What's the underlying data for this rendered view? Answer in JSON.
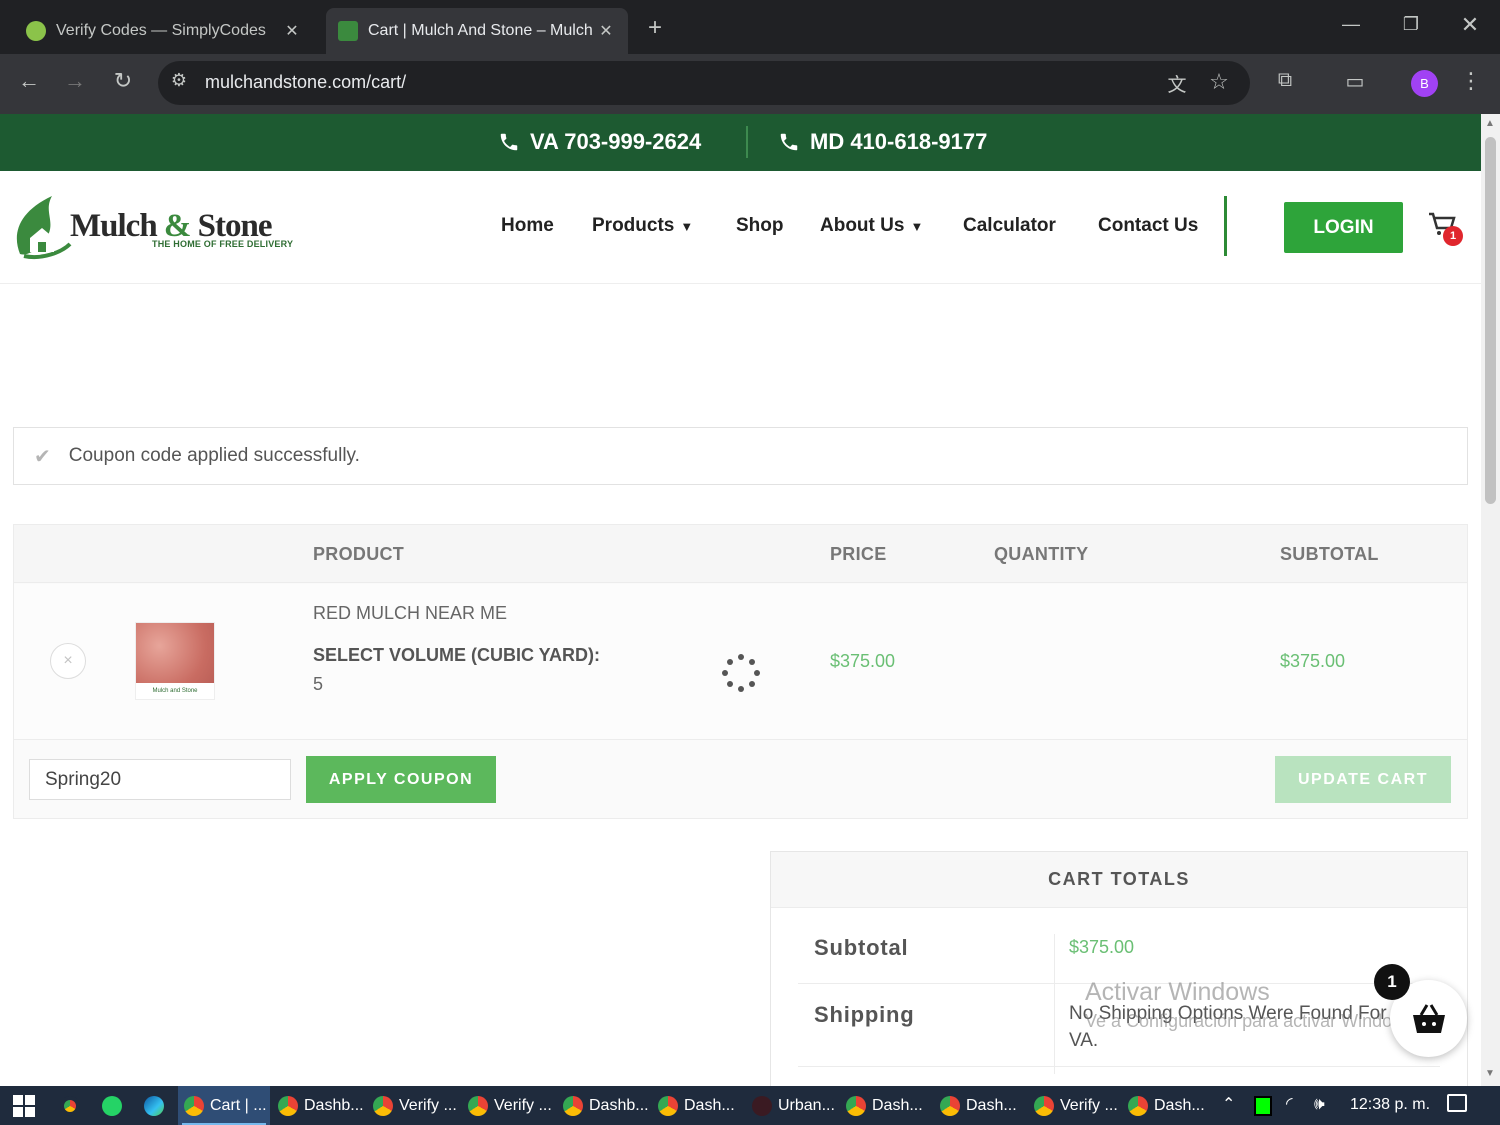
{
  "browser": {
    "tabs": [
      {
        "title": "Verify Codes — SimplyCodes",
        "active": false
      },
      {
        "title": "Cart | Mulch And Stone – Mulch",
        "active": true
      }
    ],
    "new_tab": "+",
    "url": "mulchandstone.com/cart/",
    "profile_initial": "B"
  },
  "site": {
    "phones": [
      {
        "label": "VA 703-999-2624"
      },
      {
        "label": "MD 410-618-9177"
      }
    ],
    "logo": {
      "name_part1": "Mulch ",
      "amp": "&",
      "name_part2": " Stone",
      "tagline": "THE HOME OF FREE DELIVERY"
    },
    "nav": [
      "Home",
      "Products",
      "Shop",
      "About Us",
      "Calculator",
      "Contact Us"
    ],
    "login": "LOGIN",
    "cart_count": "1"
  },
  "notice": "Coupon code applied successfully.",
  "cart": {
    "headers": {
      "product": "PRODUCT",
      "price": "PRICE",
      "quantity": "QUANTITY",
      "subtotal": "SUBTOTAL"
    },
    "item": {
      "remove": "×",
      "thumb_label": "Mulch and Stone",
      "name": "RED MULCH NEAR ME",
      "meta_key": "SELECT VOLUME (CUBIC YARD):",
      "meta_value": "5",
      "price": "$375.00",
      "subtotal": "$375.00"
    },
    "coupon_value": "Spring20",
    "apply_label": "APPLY COUPON",
    "update_label": "UPDATE CART"
  },
  "totals": {
    "heading": "CART TOTALS",
    "subtotal_label": "Subtotal",
    "subtotal_value": "$375.00",
    "shipping_label": "Shipping",
    "shipping_value": "No Shipping Options Were Found For VA."
  },
  "watermark": {
    "line1": "Activar Windows",
    "line2": "Ve a Configuración para activar Windows."
  },
  "basket_count": "1",
  "taskbar": {
    "items": [
      "Cart | ...",
      "Dashb...",
      "Verify ...",
      "Verify ...",
      "Dashb...",
      "Dash...",
      "Urban...",
      "Dash...",
      "Dash...",
      "Verify ...",
      "Dash..."
    ],
    "clock": "12:38 p. m."
  },
  "colors": {
    "brand_green": "#1d5a31",
    "button_green": "#2ea43a",
    "price_green": "#6abf74"
  }
}
